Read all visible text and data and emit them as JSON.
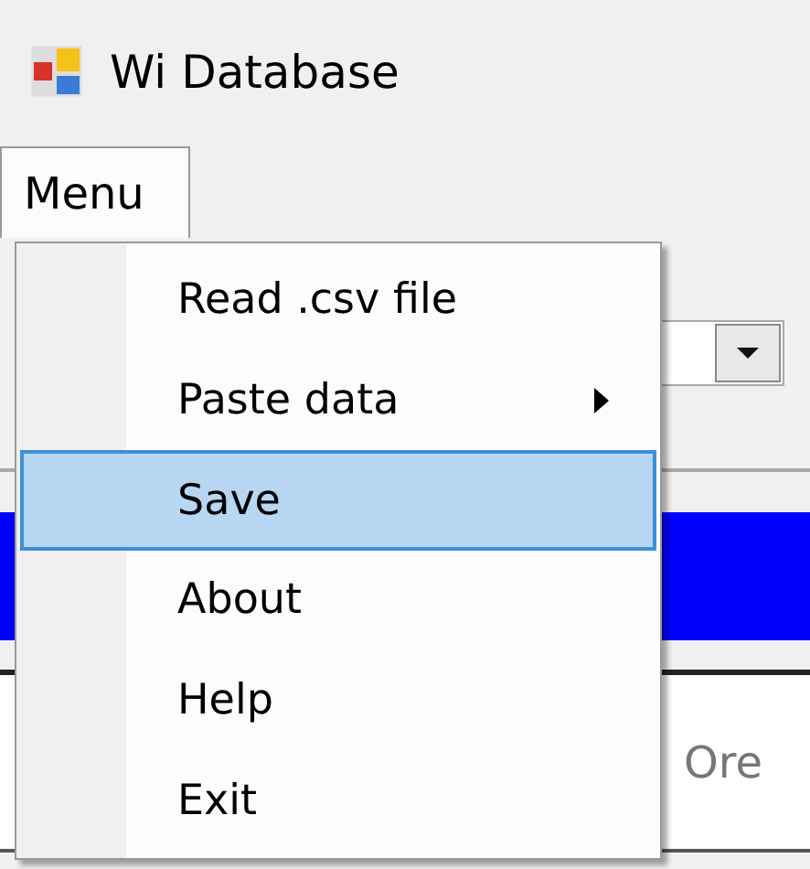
{
  "window": {
    "title": "Wi Database"
  },
  "menu_bar": [
    {
      "label": "Menu",
      "open": true
    }
  ],
  "dropdown": {
    "items": [
      {
        "label": "Read .csv file",
        "selected": false,
        "submenu": false
      },
      {
        "label": "Paste data",
        "selected": false,
        "submenu": true
      },
      {
        "label": "Save",
        "selected": true,
        "submenu": false
      },
      {
        "label": "About",
        "selected": false,
        "submenu": false
      },
      {
        "label": "Help",
        "selected": false,
        "submenu": false
      },
      {
        "label": "Exit",
        "selected": false,
        "submenu": false
      }
    ]
  },
  "grid": {
    "column_header": "Ore"
  }
}
